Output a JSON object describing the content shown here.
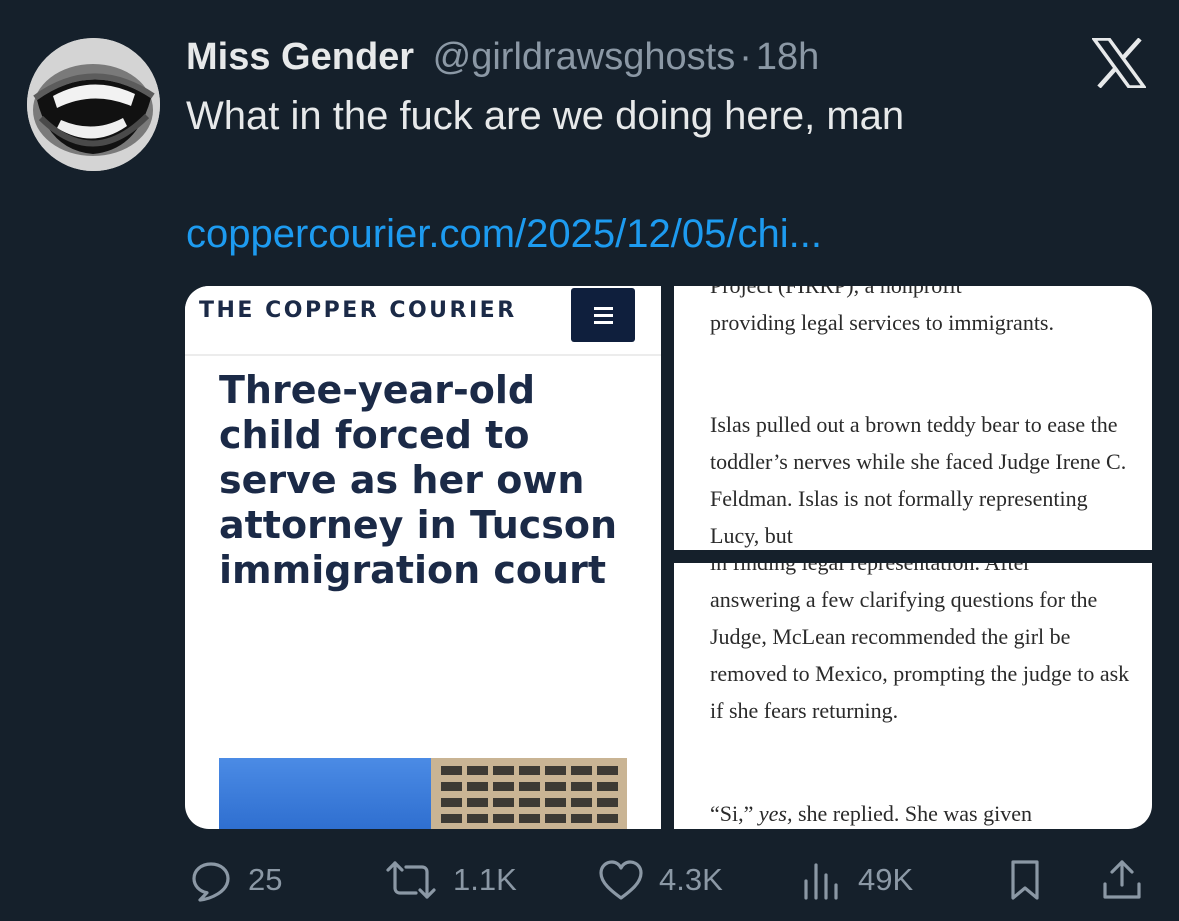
{
  "tweet": {
    "display_name": "Miss Gender",
    "handle": "@girldrawsghosts",
    "separator": "·",
    "time": "18h",
    "text": "What in the fuck are we doing here, man",
    "link": "coppercourier.com/2025/12/05/chi..."
  },
  "media": {
    "left": {
      "site_name": "THE COPPER COURIER",
      "headline": "Three-year-old child forced to serve as her own attorney in Tucson immigration court"
    },
    "top_right": {
      "clipped_top": "Project (FIRRP), a nonprofit",
      "para1": "providing legal services to immigrants.",
      "para2": "Islas pulled out a brown teddy bear to ease the toddler’s nerves while she faced Judge Irene C. Feldman. Islas is not formally representing Lucy, but"
    },
    "bottom_right": {
      "clipped_top": "in finding legal representation. After",
      "para1": "answering a few clarifying questions for the Judge, McLean recommended the girl be removed to Mexico, prompting the judge to ask if she fears returning.",
      "para2_start": "“Si,”",
      "para2_italic": "yes,",
      "para2_end": "she replied. She was given"
    }
  },
  "actions": {
    "replies": "25",
    "reposts": "1.1K",
    "likes": "4.3K",
    "views": "49K"
  },
  "colors": {
    "background": "#15202b",
    "link": "#1d9bf0",
    "muted": "#8b98a5",
    "text": "#e7e9ea",
    "courier_navy": "#1b2a47"
  }
}
